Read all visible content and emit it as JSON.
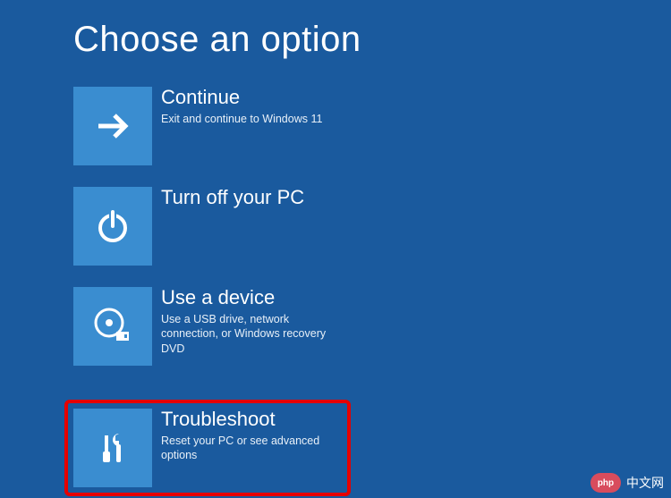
{
  "page_title": "Choose an option",
  "options": {
    "continue": {
      "title": "Continue",
      "desc": "Exit and continue to Windows 11"
    },
    "turn_off": {
      "title": "Turn off your PC",
      "desc": ""
    },
    "use_device": {
      "title": "Use a device",
      "desc": "Use a USB drive, network connection, or Windows recovery DVD"
    },
    "troubleshoot": {
      "title": "Troubleshoot",
      "desc": "Reset your PC or see advanced options"
    }
  },
  "watermark": {
    "logo_text": "php",
    "site_text": "中文网"
  }
}
